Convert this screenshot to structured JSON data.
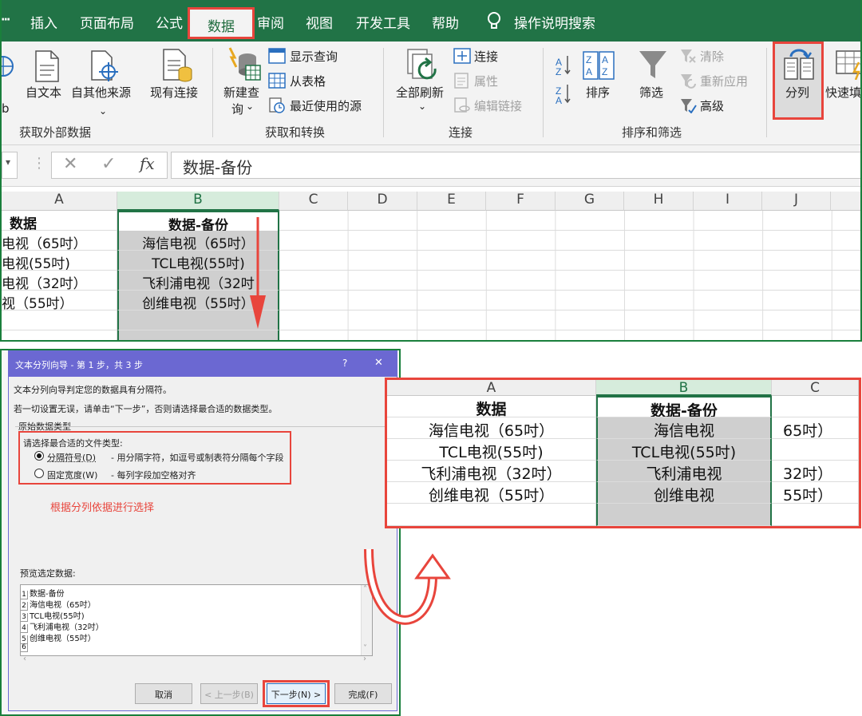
{
  "menubar": {
    "items": [
      {
        "label": "插入"
      },
      {
        "label": "页面布局"
      },
      {
        "label": "公式"
      },
      {
        "label": "数据"
      },
      {
        "label": "审阅"
      },
      {
        "label": "视图"
      },
      {
        "label": "开发工具"
      },
      {
        "label": "帮助"
      },
      {
        "label": "操作说明搜索"
      }
    ],
    "active": "数据"
  },
  "ribbon": {
    "b_fragment": "b",
    "from_text": "自文本",
    "from_other": "自其他来源",
    "existing_conn": "现有连接",
    "new_query_1": "新建查",
    "new_query_2": "询",
    "show_query": "显示查询",
    "from_table": "从表格",
    "recent_sources": "最近使用的源",
    "refresh_all": "全部刷新",
    "connections": "连接",
    "properties": "属性",
    "edit_links": "编辑链接",
    "sort": "排序",
    "filter": "筛选",
    "clear": "清除",
    "reapply": "重新应用",
    "advanced": "高级",
    "text_to_columns": "分列",
    "flash_fill": "快速填",
    "groups": {
      "get_external": "获取外部数据",
      "get_transform": "获取和转换",
      "connections": "连接",
      "sort_filter": "排序和筛选"
    }
  },
  "formula_bar": {
    "fx": "fx",
    "value": "数据-备份"
  },
  "grid_top": {
    "columns": [
      "A",
      "B",
      "C",
      "D",
      "E",
      "F",
      "G",
      "H",
      "I",
      "J"
    ],
    "header_a": "数据",
    "header_b": "数据-备份",
    "col_a": [
      "电视（65吋）",
      "电视(55吋)",
      "电视（32吋）",
      "视（55吋）"
    ],
    "col_b": [
      "海信电视（65吋）",
      "TCL电视(55吋)",
      "飞利浦电视（32吋",
      "创维电视（55吋）"
    ]
  },
  "dialog": {
    "title": "文本分列向导 - 第 1 步，共 3 步",
    "help": "?",
    "close": "✕",
    "line1": "文本分列向导判定您的数据具有分隔符。",
    "line2": "若一切设置无误，请单击“下一步”，否则请选择最合适的数据类型。",
    "section": "原始数据类型",
    "choose": "请选择最合适的文件类型:",
    "opt_delimited": "分隔符号(D)",
    "opt_delimited_desc": "- 用分隔字符，如逗号或制表符分隔每个字段",
    "opt_fixed": "固定宽度(W)",
    "opt_fixed_desc": "- 每列字段加空格对齐",
    "annotation": "根据分列依据进行选择",
    "preview_label": "预览选定数据:",
    "preview_lines": [
      "数据-备份",
      "海信电视（65吋）",
      "TCL电视(55吋)",
      "飞利浦电视（32吋）",
      "创维电视（55吋）",
      ""
    ],
    "preview_nums": [
      "1",
      "2",
      "3",
      "4",
      "5",
      "6"
    ],
    "btn_cancel": "取消",
    "btn_back": "< 上一步(B)",
    "btn_next": "下一步(N) >",
    "btn_finish": "完成(F)"
  },
  "result": {
    "columns": [
      "A",
      "B",
      "C"
    ],
    "header_a": "数据",
    "header_b": "数据-备份",
    "col_a": [
      "海信电视（65吋）",
      "TCL电视(55吋)",
      "飞利浦电视（32吋）",
      "创维电视（55吋）"
    ],
    "col_b": [
      "海信电视",
      "TCL电视(55吋)",
      "飞利浦电视",
      "创维电视"
    ],
    "col_c": [
      "65吋）",
      "",
      "32吋）",
      "55吋）"
    ]
  },
  "colors": {
    "excel_green": "#217346",
    "highlight_red": "#e8453c",
    "dialog_title": "#6b68d2"
  }
}
